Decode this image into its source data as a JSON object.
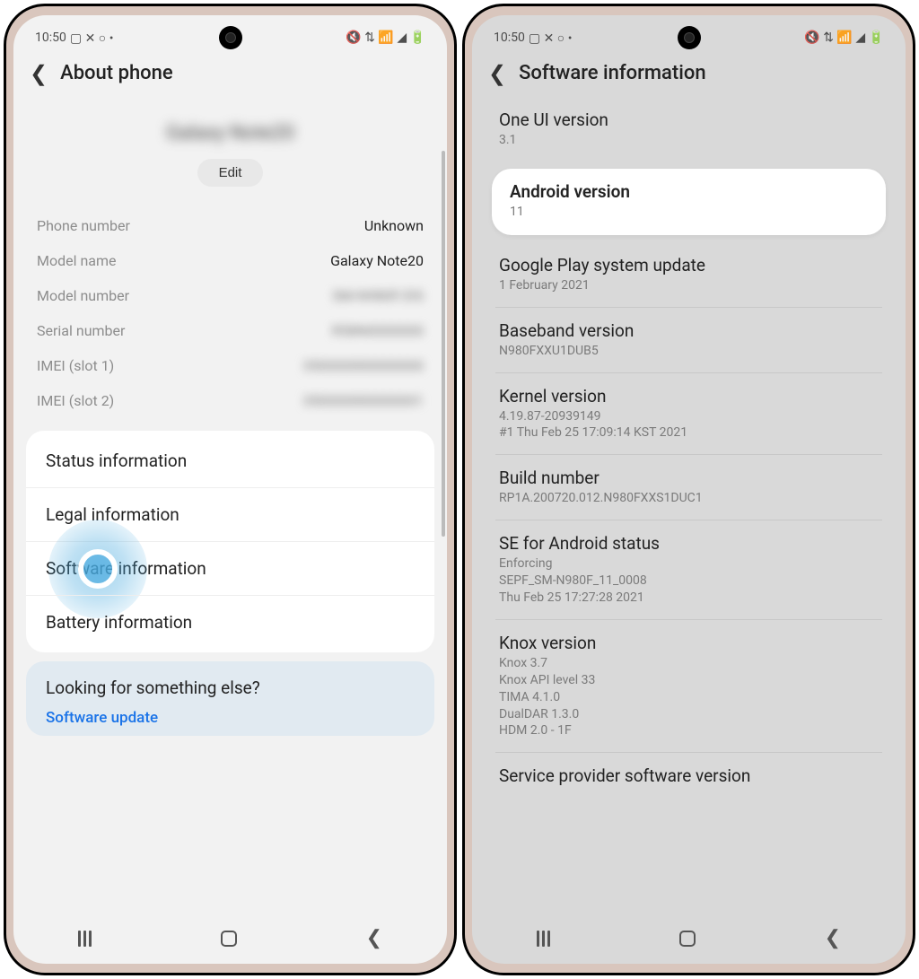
{
  "status": {
    "time": "10:50",
    "left_icons": "▢ ✕ ○ •",
    "right_icons": "🔇 ⇅ 📶 ◢ 🔋"
  },
  "left": {
    "title": "About phone",
    "device_name_blurred": "Galaxy Note20",
    "edit": "Edit",
    "rows": [
      {
        "k": "Phone number",
        "v": "Unknown",
        "blur": false
      },
      {
        "k": "Model name",
        "v": "Galaxy Note20",
        "blur": false
      },
      {
        "k": "Model number",
        "v": "SM-N980F/DS",
        "blur": true
      },
      {
        "k": "Serial number",
        "v": "R58N0000000",
        "blur": true
      },
      {
        "k": "IMEI (slot 1)",
        "v": "350000000000000",
        "blur": true
      },
      {
        "k": "IMEI (slot 2)",
        "v": "350000000000001",
        "blur": true
      }
    ],
    "links": {
      "status": "Status information",
      "legal": "Legal information",
      "software": "Software information",
      "battery": "Battery information"
    },
    "hint": {
      "title": "Looking for something else?",
      "link": "Software update"
    }
  },
  "right": {
    "title": "Software information",
    "blocks": {
      "oneui": {
        "t": "One UI version",
        "v": "3.1"
      },
      "android": {
        "t": "Android version",
        "v": "11"
      },
      "gplay": {
        "t": "Google Play system update",
        "v": "1 February 2021"
      },
      "baseband": {
        "t": "Baseband version",
        "v": "N980FXXU1DUB5"
      },
      "kernel": {
        "t": "Kernel version",
        "v": "4.19.87-20939149\n#1 Thu Feb 25 17:09:14 KST 2021"
      },
      "build": {
        "t": "Build number",
        "v": "RP1A.200720.012.N980FXXS1DUC1"
      },
      "se": {
        "t": "SE for Android status",
        "v": "Enforcing\nSEPF_SM-N980F_11_0008\nThu Feb 25 17:27:28 2021"
      },
      "knox": {
        "t": "Knox version",
        "v": "Knox 3.7\nKnox API level 33\nTIMA 4.1.0\nDualDAR 1.3.0\nHDM 2.0 - 1F"
      },
      "carrier": {
        "t": "Service provider software version",
        "v": ""
      }
    }
  }
}
